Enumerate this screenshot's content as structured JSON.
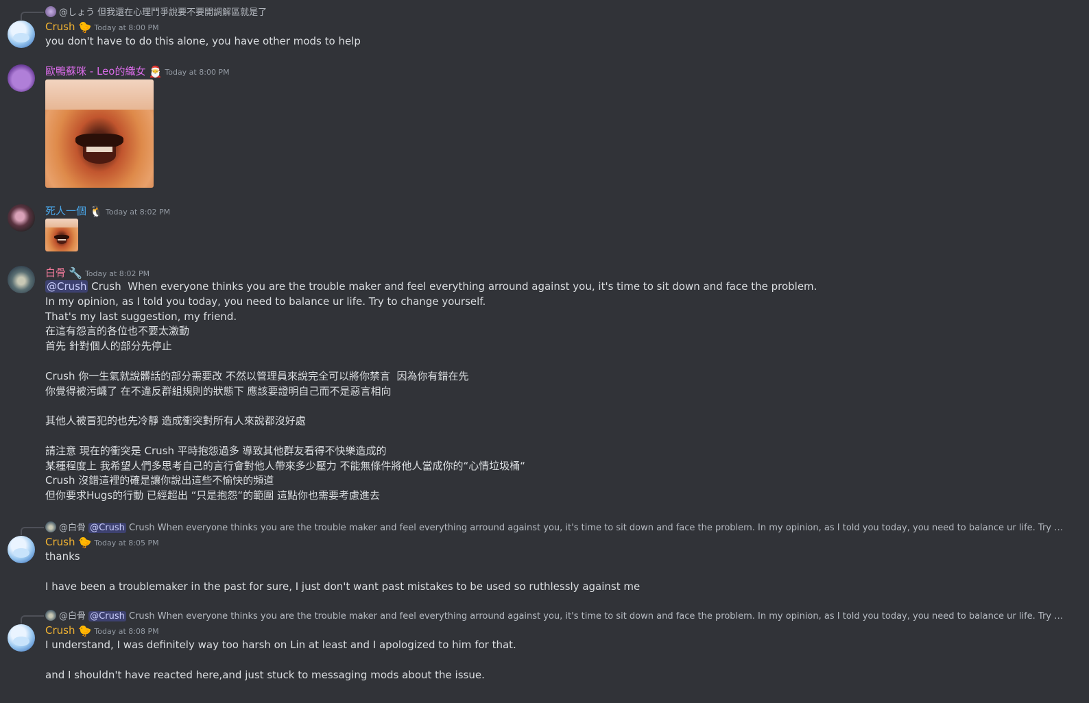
{
  "messages": [
    {
      "reply": {
        "name": "@しょう",
        "text": "但我還在心理鬥爭說要不要開調解區就是了"
      },
      "author": "Crush",
      "role_icon": "🐤",
      "timestamp": "Today at 8:00 PM",
      "lines": [
        "you don't have to do this alone, you have other mods to help"
      ]
    },
    {
      "author": "歐鴨蘇咪 - Leo的織女",
      "role_icon": "🎅",
      "timestamp": "Today at 8:00 PM",
      "image": "laughing-meme"
    },
    {
      "author": "死人一個",
      "role_icon": "🐧",
      "timestamp": "Today at 8:02 PM",
      "image": "laughing-meme-small"
    },
    {
      "author": "白骨",
      "role_icon": "🔧",
      "timestamp": "Today at 8:02 PM",
      "mention": "@Crush",
      "first_line": "Crush  When everyone thinks you are the trouble maker and feel everything arround against you, it's time to sit down and face the problem.",
      "lines": [
        "In my opinion, as I told you today, you need to balance ur life. Try to change yourself.",
        "That's my last suggestion, my friend.",
        "在這有怨言的各位也不要太激動",
        "首先 針對個人的部分先停止",
        "",
        "Crush 你一生氣就說髒話的部分需要改 不然以管理員來說完全可以將你禁言  因為你有錯在先",
        "你覺得被污衊了 在不違反群組規則的狀態下 應該要證明自己而不是惡言相向",
        "",
        "其他人被冒犯的也先冷靜 造成衝突對所有人來說都沒好處",
        "",
        "請注意 現在的衝突是 Crush 平時抱怨過多 導致其他群友看得不快樂造成的",
        "某種程度上 我希望人們多思考自己的言行會對他人帶來多少壓力 不能無條件將他人當成你的“心情垃圾桶“",
        "Crush 沒錯這裡的確是讓你說出這些不愉快的頻道",
        "但你要求Hugs的行動 已經超出 “只是抱怨“的範圍 這點你也需要考慮進去"
      ]
    },
    {
      "reply": {
        "name": "@白骨",
        "mention": "@Crush",
        "text": "Crush  When everyone thinks you are the trouble maker and feel everything arround against you, it's time to sit down and face the problem. In my opinion, as I told you today, you need to balance ur life. Try to change yourself.  That's m..."
      },
      "author": "Crush",
      "role_icon": "🐤",
      "timestamp": "Today at 8:05 PM",
      "lines": [
        "thanks",
        "",
        "I have been a troublemaker in the past for sure, I just don't want past mistakes to be used so ruthlessly against me"
      ]
    },
    {
      "reply": {
        "name": "@白骨",
        "mention": "@Crush",
        "text": "Crush  When everyone thinks you are the trouble maker and feel everything arround against you, it's time to sit down and face the problem. In my opinion, as I told you today, you need to balance ur life. Try to change yourself.  That's m..."
      },
      "author": "Crush",
      "role_icon": "🐤",
      "timestamp": "Today at 8:08 PM",
      "lines": [
        "I understand, I was definitely way too harsh on Lin at least and I apologized to him for that.",
        "",
        "and I shouldn't have reacted here,and just stuck to messaging mods about the issue."
      ]
    }
  ]
}
